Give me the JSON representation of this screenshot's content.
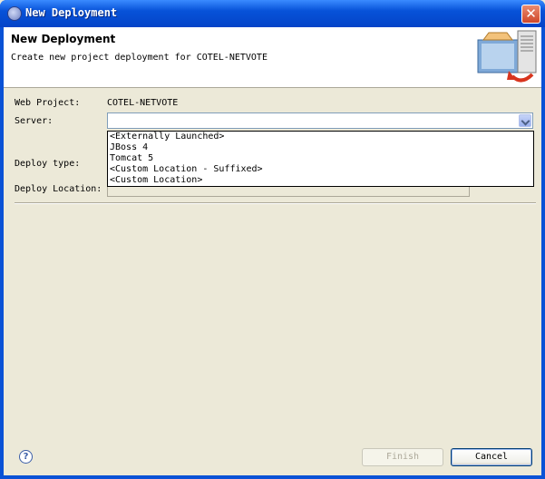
{
  "window": {
    "title": "New Deployment",
    "close_glyph": "✕"
  },
  "banner": {
    "title": "New Deployment",
    "description": "Create new project deployment for COTEL-NETVOTE"
  },
  "form": {
    "web_project_label": "Web Project:",
    "web_project_value": "COTEL-NETVOTE",
    "server_label": "Server:",
    "server_value": "",
    "deploy_type_label": "Deploy type:",
    "deploy_location_label": "Deploy Location:"
  },
  "server_options": [
    "<Externally Launched>",
    "JBoss 4",
    "Tomcat 5",
    "<Custom Location - Suffixed>",
    "<Custom Location>"
  ],
  "footer": {
    "help_glyph": "?",
    "finish_label": "Finish",
    "cancel_label": "Cancel"
  },
  "colors": {
    "titlebar": "#0752D8",
    "background": "#ECE9D8",
    "close": "#D0482A"
  }
}
